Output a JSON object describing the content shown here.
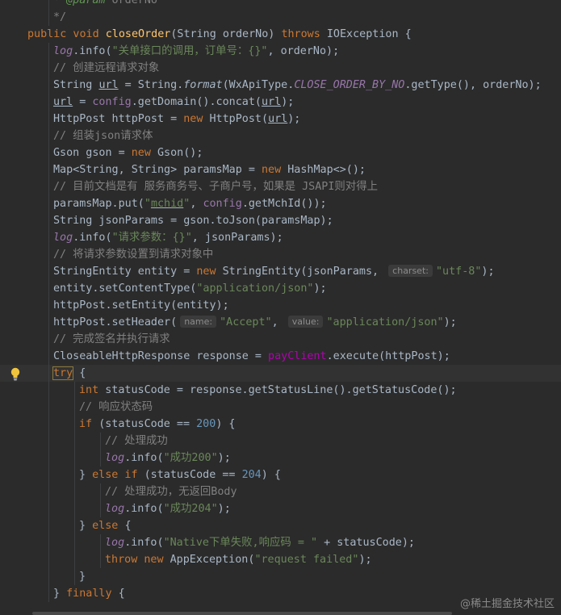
{
  "editor": {
    "lines": [
      {
        "indent": 1,
        "segments": [
          {
            "t": "* ",
            "c": "cmt"
          },
          {
            "t": "@param",
            "c": "tag"
          },
          {
            "t": " orderNo",
            "c": "cmt"
          }
        ]
      },
      {
        "indent": 1,
        "segments": [
          {
            "t": "*/",
            "c": "cmt"
          }
        ]
      },
      {
        "indent": 0,
        "segments": [
          {
            "t": "public void ",
            "c": "kw"
          },
          {
            "t": "closeOrder",
            "c": "mth"
          },
          {
            "t": "(String orderNo) "
          },
          {
            "t": "throws ",
            "c": "kw"
          },
          {
            "t": "IOException {"
          }
        ]
      },
      {
        "indent": 1,
        "segments": [
          {
            "t": "log",
            "c": "cst"
          },
          {
            "t": ".info("
          },
          {
            "t": "\"关单接口的调用，订单号：{}\"",
            "c": "str"
          },
          {
            "t": ", orderNo);"
          }
        ]
      },
      {
        "indent": 1,
        "segments": [
          {
            "t": "// 创建远程请求对象",
            "c": "cmt"
          }
        ]
      },
      {
        "indent": 1,
        "segments": [
          {
            "t": "String "
          },
          {
            "t": "url",
            "c": "ul"
          },
          {
            "t": " = String."
          },
          {
            "t": "format",
            "c": "sfn"
          },
          {
            "t": "(WxApiType."
          },
          {
            "t": "CLOSE_ORDER_BY_NO",
            "c": "cst"
          },
          {
            "t": ".getType(), orderNo);"
          }
        ]
      },
      {
        "indent": 1,
        "segments": [
          {
            "t": "url",
            "c": "ul"
          },
          {
            "t": " = "
          },
          {
            "t": "config",
            "c": "fld"
          },
          {
            "t": ".getDomain().concat("
          },
          {
            "t": "url",
            "c": "ul"
          },
          {
            "t": ");"
          }
        ]
      },
      {
        "indent": 1,
        "segments": [
          {
            "t": "HttpPost httpPost = "
          },
          {
            "t": "new ",
            "c": "kw"
          },
          {
            "t": "HttpPost("
          },
          {
            "t": "url",
            "c": "ul"
          },
          {
            "t": ");"
          }
        ]
      },
      {
        "indent": 1,
        "segments": [
          {
            "t": "// 组装json请求体",
            "c": "cmt"
          }
        ]
      },
      {
        "indent": 1,
        "segments": [
          {
            "t": "Gson gson = "
          },
          {
            "t": "new ",
            "c": "kw"
          },
          {
            "t": "Gson();"
          }
        ]
      },
      {
        "indent": 1,
        "segments": [
          {
            "t": "Map<String, String> paramsMap = "
          },
          {
            "t": "new ",
            "c": "kw"
          },
          {
            "t": "HashMap<>();"
          }
        ]
      },
      {
        "indent": 1,
        "segments": [
          {
            "t": "// 目前文档是有 服务商务号、子商户号，如果是 JSAPI则对得上",
            "c": "cmt"
          }
        ]
      },
      {
        "indent": 1,
        "segments": [
          {
            "t": "paramsMap.put("
          },
          {
            "t": "\"",
            "c": "str"
          },
          {
            "t": "mchid",
            "c": "str ul"
          },
          {
            "t": "\"",
            "c": "str"
          },
          {
            "t": ", "
          },
          {
            "t": "config",
            "c": "fld"
          },
          {
            "t": ".getMchId());"
          }
        ]
      },
      {
        "indent": 1,
        "segments": [
          {
            "t": "String jsonParams = gson.toJson(paramsMap);"
          }
        ]
      },
      {
        "indent": 1,
        "segments": [
          {
            "t": "log",
            "c": "cst"
          },
          {
            "t": ".info("
          },
          {
            "t": "\"请求参数：{}\"",
            "c": "str"
          },
          {
            "t": ", jsonParams);"
          }
        ]
      },
      {
        "indent": 1,
        "segments": [
          {
            "t": "// 将请求参数设置到请求对象中",
            "c": "cmt"
          }
        ]
      },
      {
        "indent": 1,
        "segments": [
          {
            "t": "StringEntity entity = "
          },
          {
            "t": "new ",
            "c": "kw"
          },
          {
            "t": "StringEntity(jsonParams, "
          },
          {
            "t": "charset:",
            "c": "hint"
          },
          {
            "t": "\"utf-8\"",
            "c": "str"
          },
          {
            "t": ");"
          }
        ]
      },
      {
        "indent": 1,
        "segments": [
          {
            "t": "entity.setContentType("
          },
          {
            "t": "\"application/json\"",
            "c": "str"
          },
          {
            "t": ");"
          }
        ]
      },
      {
        "indent": 1,
        "segments": [
          {
            "t": "httpPost.setEntity(entity);"
          }
        ]
      },
      {
        "indent": 1,
        "segments": [
          {
            "t": "httpPost.setHeader("
          },
          {
            "t": "name:",
            "c": "hint"
          },
          {
            "t": "\"Accept\"",
            "c": "str"
          },
          {
            "t": ", "
          },
          {
            "t": "value:",
            "c": "hint"
          },
          {
            "t": "\"application/json\"",
            "c": "str"
          },
          {
            "t": ");"
          }
        ]
      },
      {
        "indent": 1,
        "segments": [
          {
            "t": "// 完成签名并执行请求",
            "c": "cmt"
          }
        ]
      },
      {
        "indent": 1,
        "segments": [
          {
            "t": "CloseableHttpResponse response = "
          },
          {
            "t": "payClient",
            "c": "pc"
          },
          {
            "t": ".execute(httpPost);"
          }
        ]
      },
      {
        "indent": 1,
        "current": true,
        "segments": [
          {
            "t": "try",
            "c": "kw trybox"
          },
          {
            "t": " {"
          }
        ]
      },
      {
        "indent": 2,
        "segments": [
          {
            "t": "int ",
            "c": "kw"
          },
          {
            "t": "statusCode = response.getStatusLine().getStatusCode();"
          }
        ]
      },
      {
        "indent": 2,
        "segments": [
          {
            "t": "// 响应状态码",
            "c": "cmt"
          }
        ]
      },
      {
        "indent": 2,
        "segments": [
          {
            "t": "if ",
            "c": "kw"
          },
          {
            "t": "(statusCode == "
          },
          {
            "t": "200",
            "c": "num"
          },
          {
            "t": ") {"
          }
        ]
      },
      {
        "indent": 3,
        "segments": [
          {
            "t": "// 处理成功",
            "c": "cmt"
          }
        ]
      },
      {
        "indent": 3,
        "segments": [
          {
            "t": "log",
            "c": "cst"
          },
          {
            "t": ".info("
          },
          {
            "t": "\"成功200\"",
            "c": "str"
          },
          {
            "t": ");"
          }
        ]
      },
      {
        "indent": 2,
        "segments": [
          {
            "t": "} "
          },
          {
            "t": "else if ",
            "c": "kw"
          },
          {
            "t": "(statusCode == "
          },
          {
            "t": "204",
            "c": "num"
          },
          {
            "t": ") {"
          }
        ]
      },
      {
        "indent": 3,
        "segments": [
          {
            "t": "// 处理成功，无返回Body",
            "c": "cmt"
          }
        ]
      },
      {
        "indent": 3,
        "segments": [
          {
            "t": "log",
            "c": "cst"
          },
          {
            "t": ".info("
          },
          {
            "t": "\"成功204\"",
            "c": "str"
          },
          {
            "t": ");"
          }
        ]
      },
      {
        "indent": 2,
        "segments": [
          {
            "t": "} "
          },
          {
            "t": "else ",
            "c": "kw"
          },
          {
            "t": "{"
          }
        ]
      },
      {
        "indent": 3,
        "segments": [
          {
            "t": "log",
            "c": "cst"
          },
          {
            "t": ".info("
          },
          {
            "t": "\"Native下单失败,响应码 = \"",
            "c": "str"
          },
          {
            "t": " + statusCode);"
          }
        ]
      },
      {
        "indent": 3,
        "segments": [
          {
            "t": "throw new ",
            "c": "kw"
          },
          {
            "t": "AppException("
          },
          {
            "t": "\"request failed\"",
            "c": "str"
          },
          {
            "t": ");"
          }
        ]
      },
      {
        "indent": 2,
        "segments": [
          {
            "t": "}"
          }
        ]
      },
      {
        "indent": 1,
        "segments": [
          {
            "t": "} "
          },
          {
            "t": "finally ",
            "c": "kw"
          },
          {
            "t": "{"
          }
        ]
      }
    ]
  },
  "watermark": "@稀土掘金技术社区",
  "colors": {
    "background": "#2b2b2b",
    "keyword": "#cc7832",
    "string": "#6a8759",
    "number": "#6897bb",
    "comment": "#808080",
    "method": "#ffc66d",
    "field": "#9876aa"
  },
  "icons": {
    "gutter": "lightbulb-icon"
  }
}
